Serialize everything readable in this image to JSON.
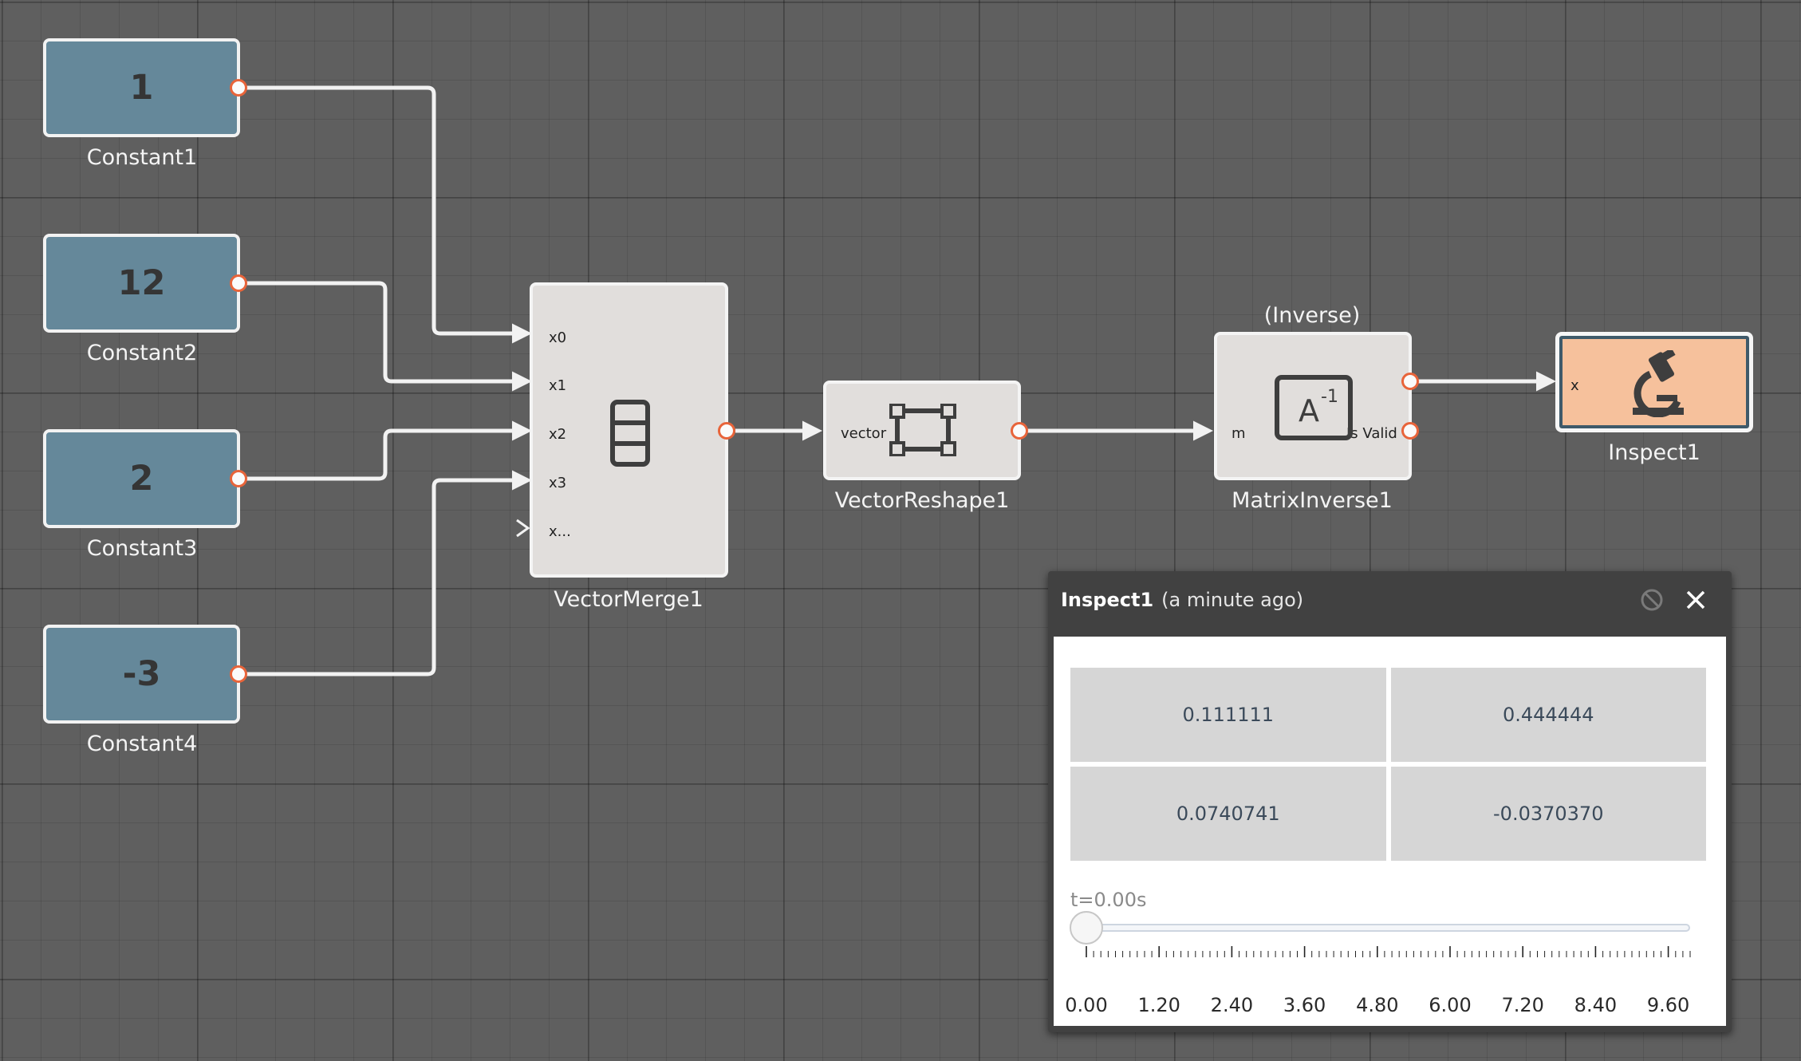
{
  "constants": [
    {
      "value": "1",
      "label": "Constant1"
    },
    {
      "value": "12",
      "label": "Constant2"
    },
    {
      "value": "2",
      "label": "Constant3"
    },
    {
      "value": "-3",
      "label": "Constant4"
    }
  ],
  "vector_merge": {
    "label": "VectorMerge1",
    "ports": [
      "x0",
      "x1",
      "x2",
      "x3",
      "x..."
    ]
  },
  "vector_reshape": {
    "label": "VectorReshape1",
    "port_in": "vector"
  },
  "matrix_inverse": {
    "label": "MatrixInverse1",
    "annotation": "(Inverse)",
    "port_in": "m",
    "port_out_valid": "Is Valid"
  },
  "inspect": {
    "label": "Inspect1",
    "port_in": "x"
  },
  "inspector_panel": {
    "title": "Inspect1",
    "subtitle": "(a minute ago)",
    "matrix": [
      "0.111111",
      "0.444444",
      "0.0740741",
      "-0.0370370"
    ],
    "time_label": "t=0.00s",
    "slider_value": 0.0,
    "slider_min": 0.0,
    "slider_max": 9.96,
    "tick_labels": [
      "0.00",
      "1.20",
      "2.40",
      "3.60",
      "4.80",
      "6.00",
      "7.20",
      "8.40",
      "9.60"
    ]
  },
  "colors": {
    "canvas": "#5f5f5f",
    "constant_fill": "#65889a",
    "block_fill": "#e1dedc",
    "inspect_fill": "#f6c19c",
    "port_ring": "#e8643a",
    "wire": "#f2f2f2"
  }
}
